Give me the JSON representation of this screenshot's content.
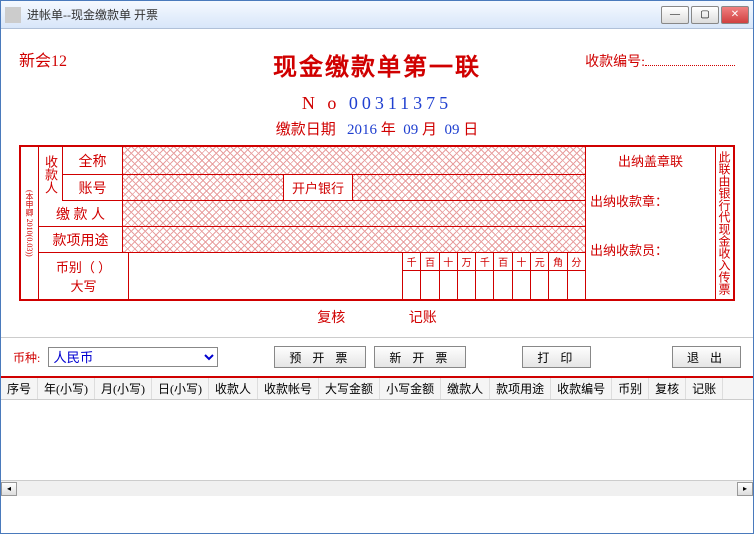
{
  "window": {
    "title": "进帐单--现金缴款单  开票"
  },
  "form": {
    "company": "新会12",
    "main_title": "现金缴款单第一联",
    "receipt_no_label": "收款编号:",
    "serial_label": "N o",
    "serial": "00311375",
    "date_label": "缴款日期",
    "year": "2016",
    "year_unit": "年",
    "month": "09",
    "month_unit": "月",
    "day": "09",
    "day_unit": "日",
    "payee_label": "收款人",
    "full_name_label": "全称",
    "account_label": "账号",
    "bank_label": "开户银行",
    "payer_label": "缴 款 人",
    "usage_label": "款项用途",
    "currency_label": "币别（    ）",
    "big_write_label": "大写",
    "digits": [
      "千",
      "百",
      "十",
      "万",
      "千",
      "百",
      "十",
      "元",
      "角",
      "分"
    ],
    "stamp_title": "出纳盖章联",
    "stamp_receive": "出纳收款章：",
    "stamp_person": "出纳收款员：",
    "side_note": "此联由银行代现金收入传票",
    "left_strip": "(本甲卿 2010(0.03))",
    "review": "复核",
    "bookkeep": "记账"
  },
  "toolbar": {
    "currency_label": "币种:",
    "currency_value": "人民币",
    "preview": "预 开 票",
    "new": "新 开 票",
    "print": "打    印",
    "exit": "退    出"
  },
  "table": {
    "headers": [
      "序号",
      "年(小写)",
      "月(小写)",
      "日(小写)",
      "收款人",
      "收款帐号",
      "大写金额",
      "小写金额",
      "缴款人",
      "款项用途",
      "收款编号",
      "币别",
      "复核",
      "记账"
    ]
  }
}
